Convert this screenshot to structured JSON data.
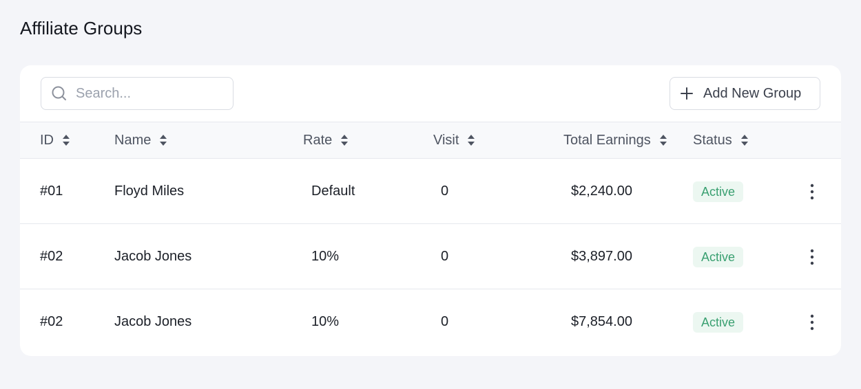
{
  "page": {
    "title": "Affiliate Groups"
  },
  "toolbar": {
    "search_placeholder": "Search...",
    "search_icon": "search-icon",
    "add_button_label": "Add New Group",
    "add_icon": "plus-icon"
  },
  "table": {
    "columns": [
      {
        "key": "id",
        "label": "ID"
      },
      {
        "key": "name",
        "label": "Name"
      },
      {
        "key": "rate",
        "label": "Rate"
      },
      {
        "key": "visit",
        "label": "Visit"
      },
      {
        "key": "total_earnings",
        "label": "Total Earnings"
      },
      {
        "key": "status",
        "label": "Status"
      }
    ],
    "rows": [
      {
        "id": "#01",
        "name": "Floyd Miles",
        "rate": "Default",
        "visit": "0",
        "total_earnings": "$2,240.00",
        "status": "Active"
      },
      {
        "id": "#02",
        "name": "Jacob Jones",
        "rate": "10%",
        "visit": "0",
        "total_earnings": "$3,897.00",
        "status": "Active"
      },
      {
        "id": "#02",
        "name": "Jacob Jones",
        "rate": "10%",
        "visit": "0",
        "total_earnings": "$7,854.00",
        "status": "Active"
      }
    ]
  },
  "colors": {
    "background": "#f4f5f9",
    "card": "#ffffff",
    "status_active_text": "#3aa071",
    "status_active_bg": "#ecf7f1"
  }
}
